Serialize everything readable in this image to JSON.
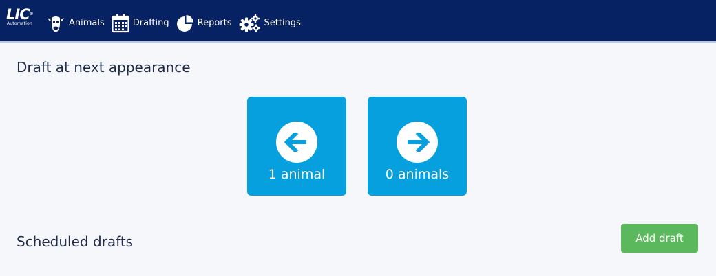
{
  "nav": {
    "logo_text": "LIC",
    "logo_sub": "Automation",
    "logo_mark": "®",
    "items": [
      {
        "label": "Animals",
        "icon": "cow-icon"
      },
      {
        "label": "Drafting",
        "icon": "calendar-icon",
        "active": true
      },
      {
        "label": "Reports",
        "icon": "pie-chart-icon"
      },
      {
        "label": "Settings",
        "icon": "gears-icon"
      }
    ]
  },
  "draft_next": {
    "title": "Draft at next appearance",
    "left_tile": {
      "count_label": "1 animal",
      "icon": "arrow-left-icon"
    },
    "right_tile": {
      "count_label": "0 animals",
      "icon": "arrow-right-icon"
    }
  },
  "scheduled": {
    "title": "Scheduled drafts",
    "add_button": "Add draft"
  },
  "colors": {
    "nav_bg": "#062262",
    "accent": "#f08a24",
    "tile": "#06a0df",
    "add_button": "#5cb85c"
  }
}
